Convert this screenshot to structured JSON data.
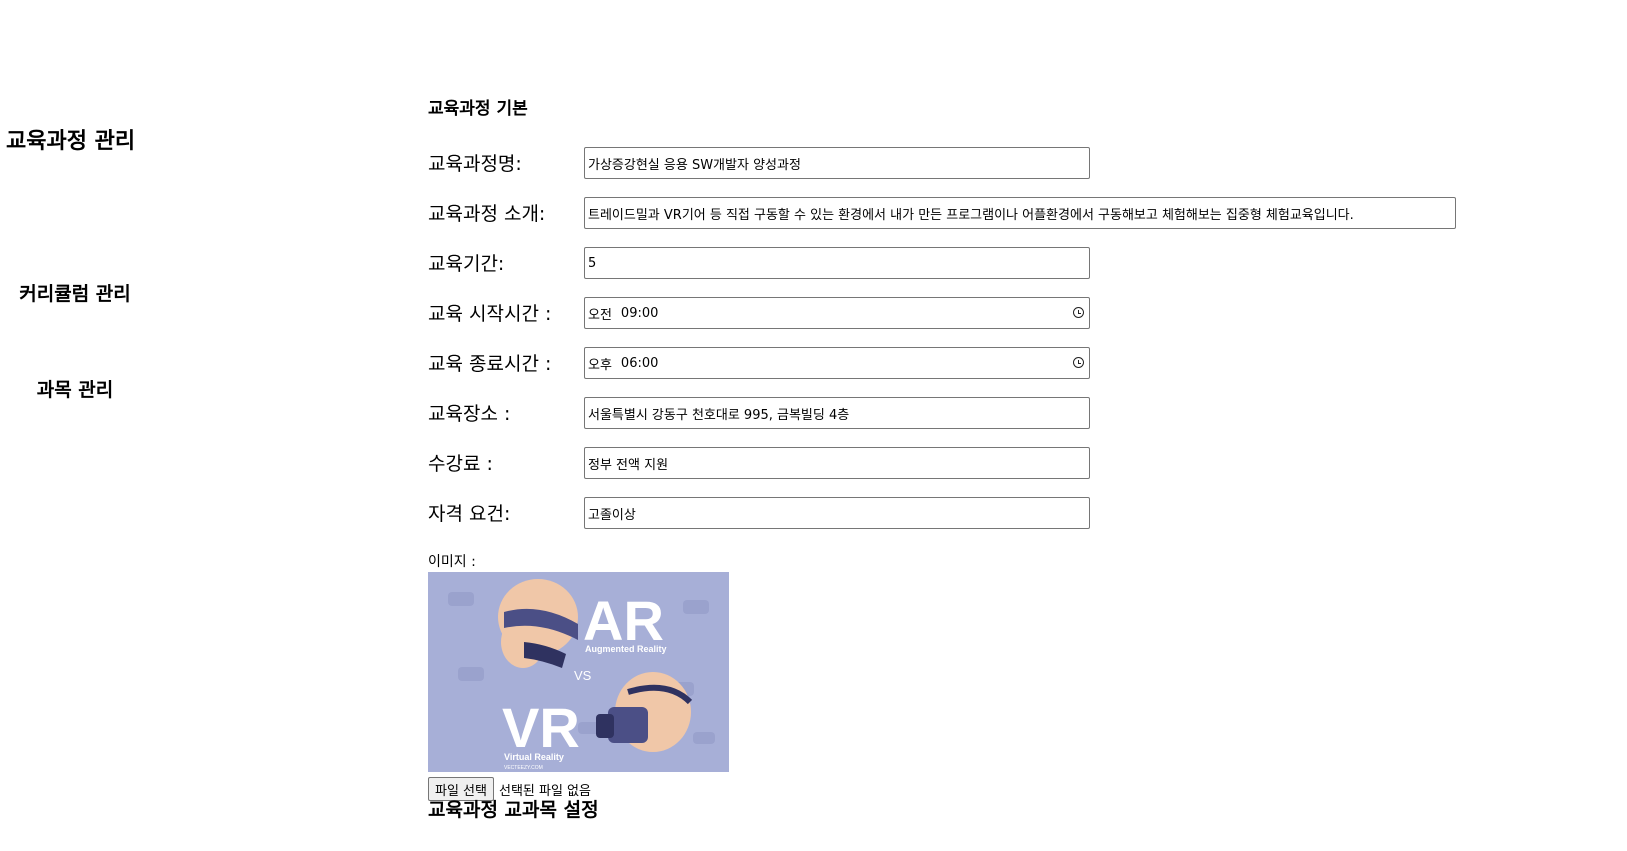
{
  "sidebar": {
    "title": "교육과정 관리",
    "items": [
      {
        "label": "커리큘럼 관리"
      },
      {
        "label": "과목 관리"
      }
    ]
  },
  "form": {
    "section_heading": "교육과정 기본",
    "fields": {
      "name": {
        "label": "교육과정명:",
        "value": "가상증강현실 응용 SW개발자 양성과정"
      },
      "intro": {
        "label": "교육과정 소개:",
        "value": "트레이드밀과 VR기어 등 직접 구동할 수 있는 환경에서 내가 만든 프로그램이나 어플환경에서 구동해보고 체험해보는 집중형 체험교육입니다."
      },
      "duration": {
        "label": "교육기간:",
        "value": "5"
      },
      "start_time": {
        "label": "교육 시작시간 :",
        "ampm": "오전",
        "time": "09:00"
      },
      "end_time": {
        "label": "교육 종료시간 :",
        "ampm": "오후",
        "time": "06:00"
      },
      "location": {
        "label": "교육장소 :",
        "value": "서울특별시 강동구 천호대로 995, 금복빌딩 4층"
      },
      "fee": {
        "label": "수강료 :",
        "value": "정부 전액 지원"
      },
      "requirement": {
        "label": "자격 요건:",
        "value": "고졸이상"
      }
    },
    "image": {
      "label": "이미지 :",
      "text_ar": "AR",
      "text_ar_sub": "Augmented Reality",
      "text_vs": "VS",
      "text_vr": "VR",
      "text_vr_sub": "Virtual Reality",
      "text_credit": "VECTEEZY.COM",
      "colors": {
        "background": "#a7afd7",
        "headset": "#4b4f86",
        "skin": "#f0c7a8"
      }
    },
    "file_input": {
      "button_label": "파일 선택",
      "status": "선택된 파일 없음"
    },
    "bottom_heading": "교육과정 교과목 설정"
  }
}
